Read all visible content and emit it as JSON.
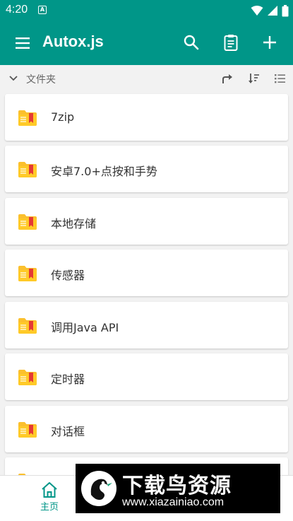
{
  "status_bar": {
    "time": "4:20",
    "notification_letter": "A"
  },
  "app_bar": {
    "title": "Autox.js",
    "icons": [
      "menu-icon",
      "search-icon",
      "clipboard-icon",
      "add-icon"
    ]
  },
  "sub_bar": {
    "label": "文件夹",
    "icons": [
      "chevron-down-icon",
      "go-up-icon",
      "sort-icon",
      "list-view-icon"
    ]
  },
  "folders": [
    {
      "name": "7zip"
    },
    {
      "name": "安卓7.0+点按和手势"
    },
    {
      "name": "本地存储"
    },
    {
      "name": "传感器"
    },
    {
      "name": "调用Java API"
    },
    {
      "name": "定时器"
    },
    {
      "name": "对话框"
    },
    {
      "name": ""
    }
  ],
  "bottom_nav": {
    "home_label": "主页"
  },
  "watermark": {
    "title": "下载鸟资源",
    "url": "www.xiazainiao.com"
  },
  "colors": {
    "primary": "#009688",
    "folder": "#FBC02D",
    "bookmark": "#E53935"
  }
}
